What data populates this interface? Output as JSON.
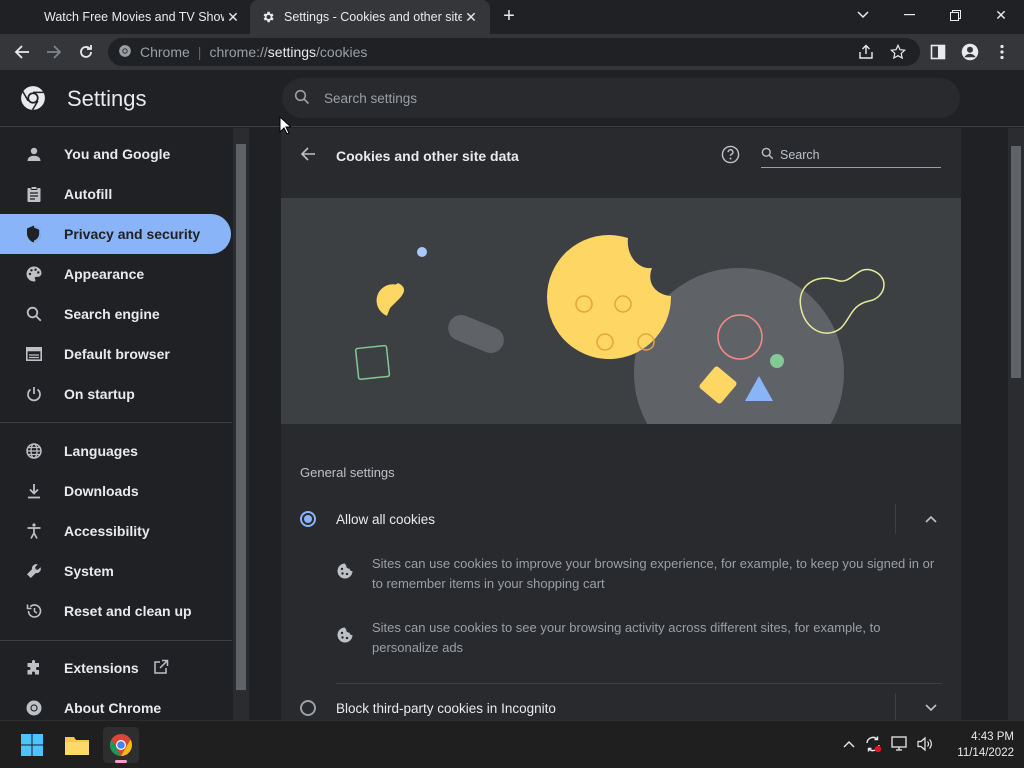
{
  "tabs": [
    {
      "title": "Watch Free Movies and TV Shows"
    },
    {
      "title": "Settings - Cookies and other site data"
    }
  ],
  "toolbar": {
    "omnibox_scheme": "Chrome",
    "omnibox_url_prefix": "chrome://",
    "omnibox_url_host": "settings",
    "omnibox_url_path": "/cookies"
  },
  "header": {
    "title": "Settings",
    "search_placeholder": "Search settings"
  },
  "sidebar": {
    "items": [
      {
        "label": "You and Google",
        "icon": "person-icon"
      },
      {
        "label": "Autofill",
        "icon": "clipboard-icon"
      },
      {
        "label": "Privacy and security",
        "icon": "shield-icon",
        "active": true
      },
      {
        "label": "Appearance",
        "icon": "palette-icon"
      },
      {
        "label": "Search engine",
        "icon": "search-icon"
      },
      {
        "label": "Default browser",
        "icon": "browser-icon"
      },
      {
        "label": "On startup",
        "icon": "power-icon"
      },
      {
        "label": "Languages",
        "icon": "globe-icon"
      },
      {
        "label": "Downloads",
        "icon": "download-icon"
      },
      {
        "label": "Accessibility",
        "icon": "accessibility-icon"
      },
      {
        "label": "System",
        "icon": "wrench-icon"
      },
      {
        "label": "Reset and clean up",
        "icon": "restore-icon"
      },
      {
        "label": "Extensions",
        "icon": "puzzle-icon"
      },
      {
        "label": "About Chrome",
        "icon": "chrome-icon"
      }
    ]
  },
  "page": {
    "title": "Cookies and other site data",
    "search_placeholder": "Search",
    "section_title": "General settings",
    "options": [
      {
        "label": "Allow all cookies",
        "selected": true,
        "details": [
          "Sites can use cookies to improve your browsing experience, for example, to keep you signed in or to remember items in your shopping cart",
          "Sites can use cookies to see your browsing activity across different sites, for example, to personalize ads"
        ]
      },
      {
        "label": "Block third-party cookies in Incognito",
        "selected": false
      }
    ]
  },
  "taskbar": {
    "time": "4:43 PM",
    "date": "11/14/2022"
  },
  "colors": {
    "accent": "#8ab4f8",
    "background": "#202124",
    "surface": "#292a2d",
    "cookie": "#fdd663"
  }
}
